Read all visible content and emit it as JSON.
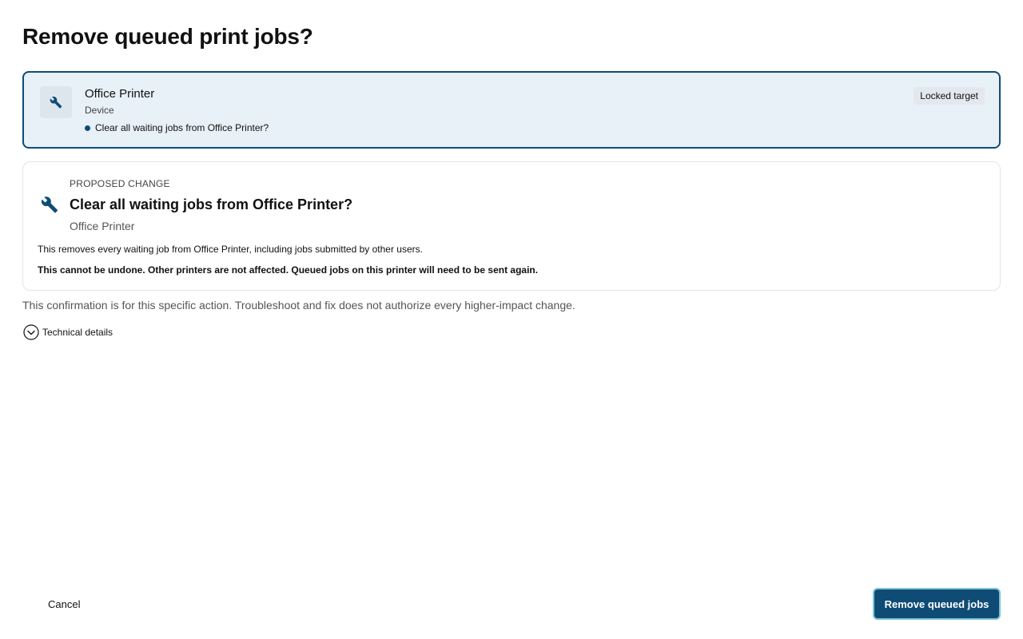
{
  "dialog": {
    "title": "Remove queued print jobs?"
  },
  "target": {
    "name": "Office Printer",
    "kind": "Device",
    "action": "Clear all waiting jobs from Office Printer?",
    "badge": "Locked target",
    "icon": "wrench-icon"
  },
  "proposed_change": {
    "eyebrow": "PROPOSED CHANGE",
    "title": "Clear all waiting jobs from Office Printer?",
    "subject": "Office Printer",
    "description": "This removes every waiting job from Office Printer, including jobs submitted by other users.",
    "warning": "This cannot be undone. Other printers are not affected. Queued jobs on this printer will need to be sent again.",
    "icon": "wrench-icon"
  },
  "note": "This confirmation is for this specific action. Troubleshoot and fix does not authorize every higher-impact change.",
  "details": {
    "label": "Technical details",
    "icon": "chevron-down-circle-icon"
  },
  "buttons": {
    "cancel": "Cancel",
    "confirm": "Remove queued jobs"
  },
  "colors": {
    "accent": "#0f4c75",
    "target_bg": "#e8f0f8",
    "focus_ring": "#7fc4d8"
  }
}
